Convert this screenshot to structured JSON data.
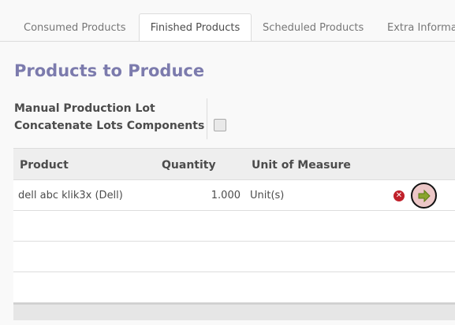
{
  "tabs": [
    {
      "label": "Consumed Products"
    },
    {
      "label": "Finished Products"
    },
    {
      "label": "Scheduled Products"
    },
    {
      "label": "Extra Information"
    }
  ],
  "section": {
    "title": "Products to Produce"
  },
  "fields": {
    "manual_lot": "Manual Production Lot",
    "concat_lots": "Concatenate Lots Components",
    "concat_lots_checked": false
  },
  "table": {
    "headers": {
      "product": "Product",
      "quantity": "Quantity",
      "uom": "Unit of Measure"
    },
    "rows": [
      {
        "product": "dell abc klik3x (Dell)",
        "quantity": "1.000",
        "uom": "Unit(s)"
      }
    ]
  },
  "icons": {
    "delete": "delete-icon",
    "produce": "arrow-right-icon"
  },
  "colors": {
    "title": "#7c7bad",
    "delete": "#c0202a",
    "produce_arrow": "#8aa52c"
  }
}
